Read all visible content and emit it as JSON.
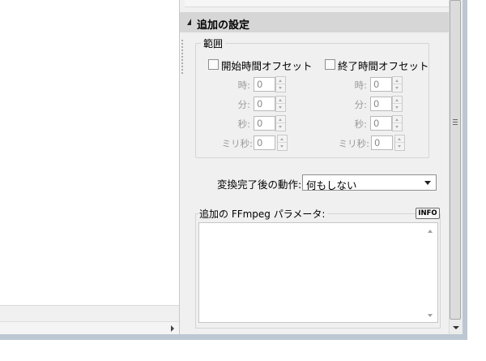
{
  "section": {
    "title": "追加の設定"
  },
  "range": {
    "group_label": "範囲",
    "start_offset": {
      "checkbox_label": "開始時間オフセット",
      "fields": [
        {
          "label": "時:",
          "value": "0"
        },
        {
          "label": "分:",
          "value": "0"
        },
        {
          "label": "秒:",
          "value": "0"
        },
        {
          "label": "ミリ秒:",
          "value": "0"
        }
      ]
    },
    "end_offset": {
      "checkbox_label": "終了時間オフセット",
      "fields": [
        {
          "label": "時:",
          "value": "0"
        },
        {
          "label": "分:",
          "value": "0"
        },
        {
          "label": "秒:",
          "value": "0"
        },
        {
          "label": "ミリ秒:",
          "value": "0"
        }
      ]
    }
  },
  "after_conversion": {
    "label": "変換完了後の動作:",
    "selected": "何もしない"
  },
  "ffmpeg_params": {
    "label": "追加の FFmpeg パラメータ:",
    "info_button": "INFO",
    "value": ""
  },
  "icons": {
    "collapse": "triangle-down-icon",
    "spin": "spin-arrows-icon",
    "dropdown": "chevron-down-icon",
    "scroll_right": "arrow-right-icon"
  },
  "colors": {
    "panel_bg": "#f0f0f0",
    "section_header_bg": "#d6d6d6",
    "disabled_text": "#9a9a9a",
    "window_frame": "#bcc7d2"
  }
}
